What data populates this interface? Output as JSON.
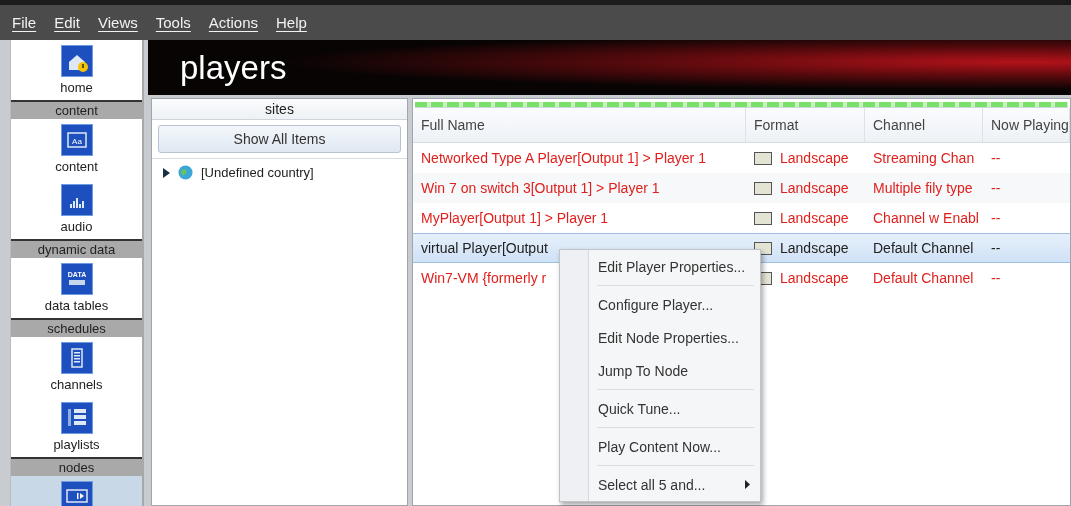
{
  "menu": [
    "File",
    "Edit",
    "Views",
    "Tools",
    "Actions",
    "Help"
  ],
  "sidebar": [
    {
      "kind": "item",
      "label": "home",
      "selected": false
    },
    {
      "kind": "header",
      "label": "content"
    },
    {
      "kind": "item",
      "label": "content",
      "icon_text": "Aa",
      "selected": false
    },
    {
      "kind": "item",
      "label": "audio",
      "selected": false
    },
    {
      "kind": "header",
      "label": "dynamic data"
    },
    {
      "kind": "item",
      "label": "data tables",
      "icon_text": "DATA",
      "selected": false
    },
    {
      "kind": "header",
      "label": "schedules"
    },
    {
      "kind": "item",
      "label": "channels",
      "selected": false
    },
    {
      "kind": "item",
      "label": "playlists",
      "selected": false
    },
    {
      "kind": "header",
      "label": "nodes"
    },
    {
      "kind": "item",
      "selected": true
    }
  ],
  "banner": {
    "title": "players"
  },
  "sites": {
    "title": "sites",
    "button": "Show All Items",
    "tree": [
      {
        "label": "[Undefined country]",
        "expanded": false
      }
    ]
  },
  "table": {
    "columns": [
      "Full Name",
      "Format",
      "Channel",
      "Now Playing"
    ],
    "rows": [
      {
        "cells": [
          "Networked Type A Player[Output 1] > Player 1",
          "Landscape",
          "Streaming Chan",
          "--"
        ],
        "color": "#e0201c",
        "selected": false
      },
      {
        "cells": [
          "Win 7 on switch 3[Output 1] > Player 1",
          "Landscape",
          "Multiple fily type",
          "--"
        ],
        "color": "#e0201c",
        "selected": false
      },
      {
        "cells": [
          "MyPlayer[Output 1] > Player 1",
          "Landscape",
          "Channel w Enabl",
          "--"
        ],
        "color": "#e0201c",
        "selected": false
      },
      {
        "cells": [
          "virtual Player[Output",
          "Landscape",
          "Default Channel",
          "--"
        ],
        "color": "#222222",
        "selected": true
      },
      {
        "cells": [
          "Win7-VM {formerly r",
          "Landscape",
          "Default Channel",
          "--"
        ],
        "color": "#e0201c",
        "selected": false
      }
    ]
  },
  "context_menu": {
    "groups": [
      [
        {
          "label": "Edit Player Properties...",
          "submenu": false
        }
      ],
      [
        {
          "label": "Configure Player...",
          "submenu": false
        },
        {
          "label": "Edit Node Properties...",
          "submenu": false
        },
        {
          "label": "Jump To Node",
          "submenu": false
        }
      ],
      [
        {
          "label": "Quick Tune...",
          "submenu": false
        }
      ],
      [
        {
          "label": "Play Content Now...",
          "submenu": false
        }
      ],
      [
        {
          "label": "Select all 5 and...",
          "submenu": true
        }
      ]
    ]
  }
}
